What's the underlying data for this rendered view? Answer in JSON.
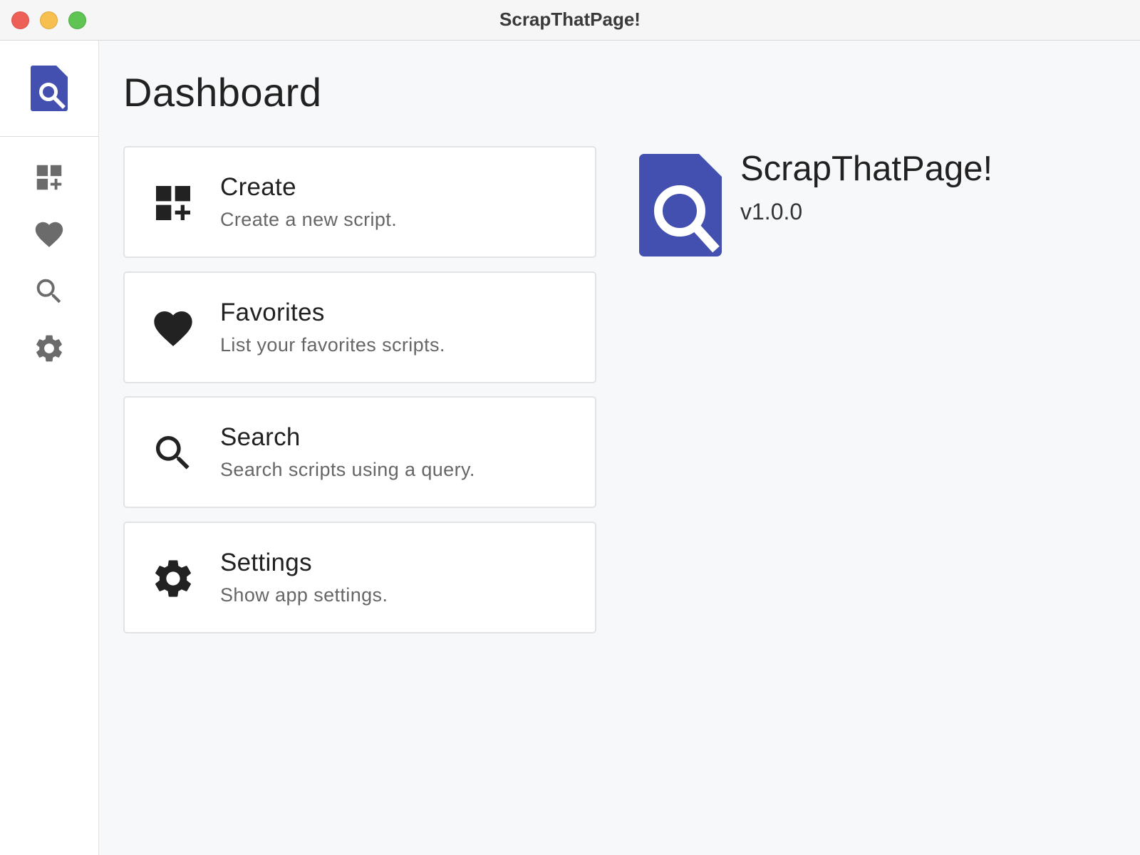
{
  "window": {
    "title": "ScrapThatPage!"
  },
  "colors": {
    "brand": "#4350af",
    "sidebar_icon": "#6b6b6b",
    "card_icon": "#222222",
    "close": "#ee5f57",
    "minimize": "#f6bf4f",
    "zoom": "#5fc454"
  },
  "sidebar": {
    "logo_icon": "app-logo-icon",
    "items": [
      {
        "icon": "dashboard-add-icon",
        "target": "create"
      },
      {
        "icon": "heart-icon",
        "target": "favorites"
      },
      {
        "icon": "search-icon",
        "target": "search"
      },
      {
        "icon": "gear-icon",
        "target": "settings"
      }
    ]
  },
  "main": {
    "title": "Dashboard",
    "cards": [
      {
        "title": "Create",
        "description": "Create a new script.",
        "icon": "dashboard-add-icon"
      },
      {
        "title": "Favorites",
        "description": "List your favorites scripts.",
        "icon": "heart-icon"
      },
      {
        "title": "Search",
        "description": "Search scripts using a query.",
        "icon": "search-icon"
      },
      {
        "title": "Settings",
        "description": "Show app settings.",
        "icon": "gear-icon"
      }
    ]
  },
  "about": {
    "name": "ScrapThatPage!",
    "version": "v1.0.0"
  }
}
